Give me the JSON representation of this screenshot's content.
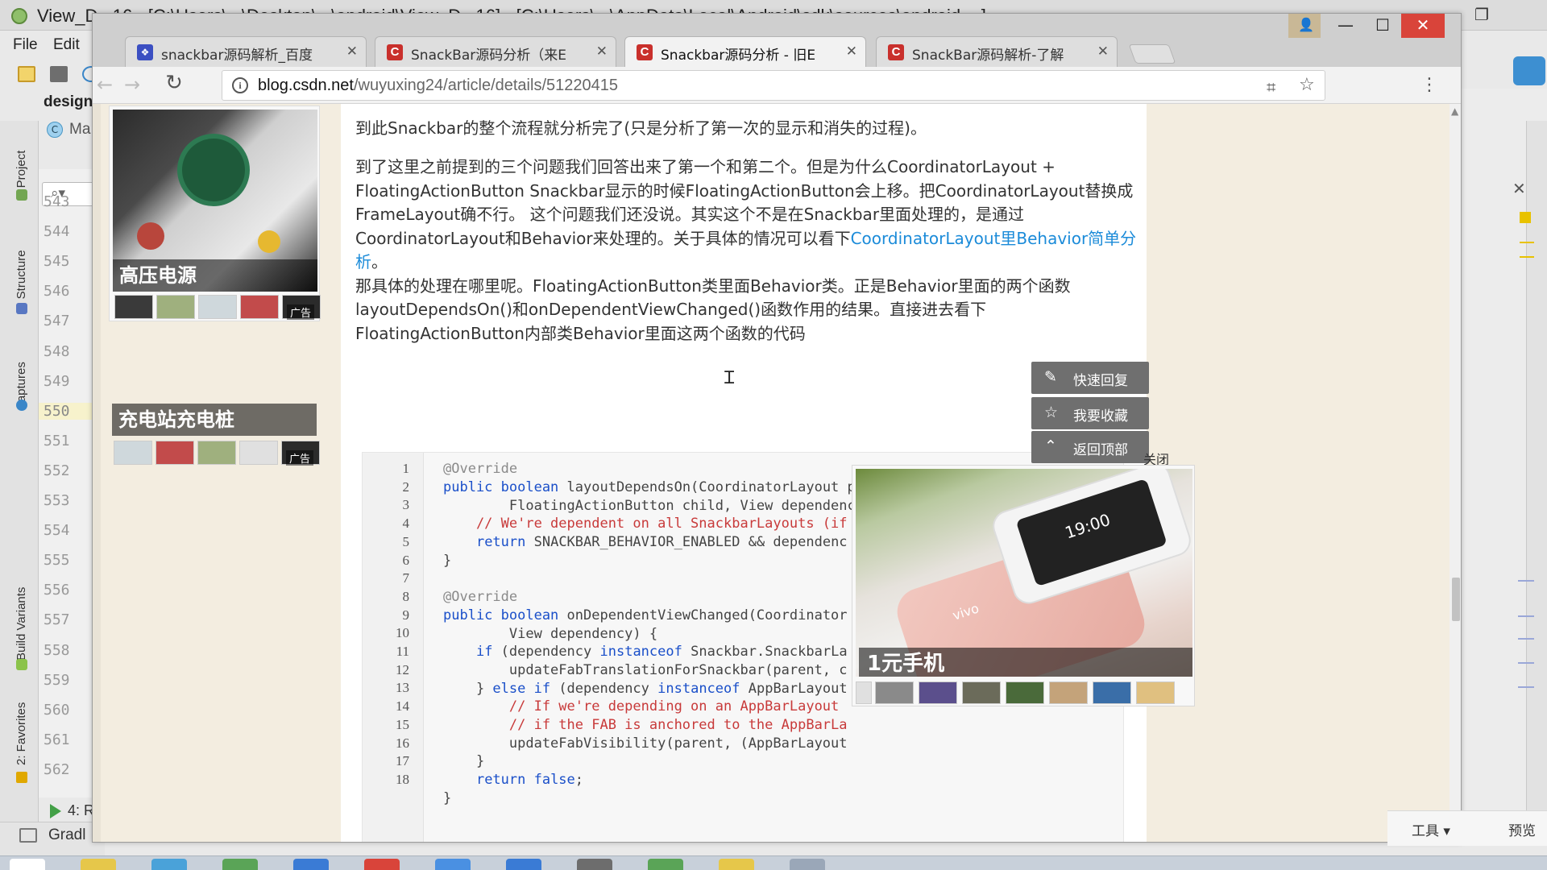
{
  "ide": {
    "title": "View_D...16 - [C:\\Users\\...\\Desktop\\...\\android\\View_D...16] - [C:\\Users\\...\\AppData\\Local\\Android\\sdk\\sources\\android-...]",
    "menu": [
      "File",
      "Edit"
    ],
    "design_label": "design",
    "ma_label": "Ma",
    "ma_icon": "C",
    "left_tabs": [
      "1: Project",
      "7: Structure",
      "Captures",
      "Build Variants",
      "2: Favorites"
    ],
    "line_numbers": [
      "543",
      "544",
      "545",
      "546",
      "547",
      "548",
      "549",
      "550",
      "551",
      "552",
      "553",
      "554",
      "555",
      "556",
      "557",
      "558",
      "559",
      "560",
      "561",
      "562"
    ],
    "current_line": "550",
    "run_label": "4: R",
    "gradle_label": "Gradl"
  },
  "browser": {
    "tabs": [
      {
        "label": "snackbar源码解析_百度",
        "favicon": "baidu-paw-icon",
        "active": false
      },
      {
        "label": "SnackBar源码分析（来E",
        "favicon": "csdn-icon",
        "active": false
      },
      {
        "label": "Snackbar源码分析 - 旧E",
        "favicon": "csdn-icon",
        "active": true
      },
      {
        "label": "SnackBar源码解析-了解",
        "favicon": "csdn-icon",
        "active": false
      }
    ],
    "url": {
      "host": "blog.csdn.net",
      "path": "/wuyuxing24/article/details/51220415"
    },
    "window_buttons": {
      "minimize": "—",
      "maximize": "☐",
      "close": "✕"
    }
  },
  "ads": {
    "left_top_caption": "高压电源",
    "left_bottom_caption": "充电站充电桩",
    "ad_tag": "广告",
    "popup_caption": "1元手机",
    "popup_close": "关闭",
    "popup_phone_time": "19:00",
    "popup_brand": "vivo"
  },
  "article": {
    "p1": "到此Snackbar的整个流程就分析完了(只是分析了第一次的显示和消失的过程)。",
    "p2_line1": "到了这里之前提到的三个问题我们回答出来了第一个和第二个。但是为什么CoordinatorLayout +",
    "p2_line2": "FloatingActionButton Snackbar显示的时候FloatingActionButton会上移。把CoordinatorLayout替换成",
    "p2_line3": "FrameLayout确不行。 这个问题我们还没说。其实这个不是在Snackbar里面处理的，是通过",
    "p2_line4_text": "CoordinatorLayout和Behavior来处理的。关于具体的情况可以看下",
    "p2_link_part1": "CoordinatorLayout里Behavior简单分",
    "p2_link_part2": "析",
    "p2_line5_tail": "。",
    "p3_line1": "那具体的处理在哪里呢。FloatingActionButton类里面Behavior类。正是Behavior里面的两个函数",
    "p3_line2": "layoutDependsOn()和onDependentViewChanged()函数作用的结果。直接进去看下",
    "p3_line3": "FloatingActionButton内部类Behavior里面这两个函数的代码"
  },
  "code": {
    "line_numbers": [
      "1",
      "2",
      "3",
      "4",
      "5",
      "6",
      "7",
      "8",
      "9",
      "10",
      "11",
      "12",
      "13",
      "14",
      "15",
      "16",
      "17",
      "18"
    ]
  },
  "float_buttons": [
    {
      "label": "快速回复",
      "icon": "pencil-icon"
    },
    {
      "label": "我要收藏",
      "icon": "star-icon"
    },
    {
      "label": "返回顶部",
      "icon": "chevron-up-icon"
    }
  ],
  "tools": {
    "tools_label": "工具",
    "preview_label": "预览"
  }
}
